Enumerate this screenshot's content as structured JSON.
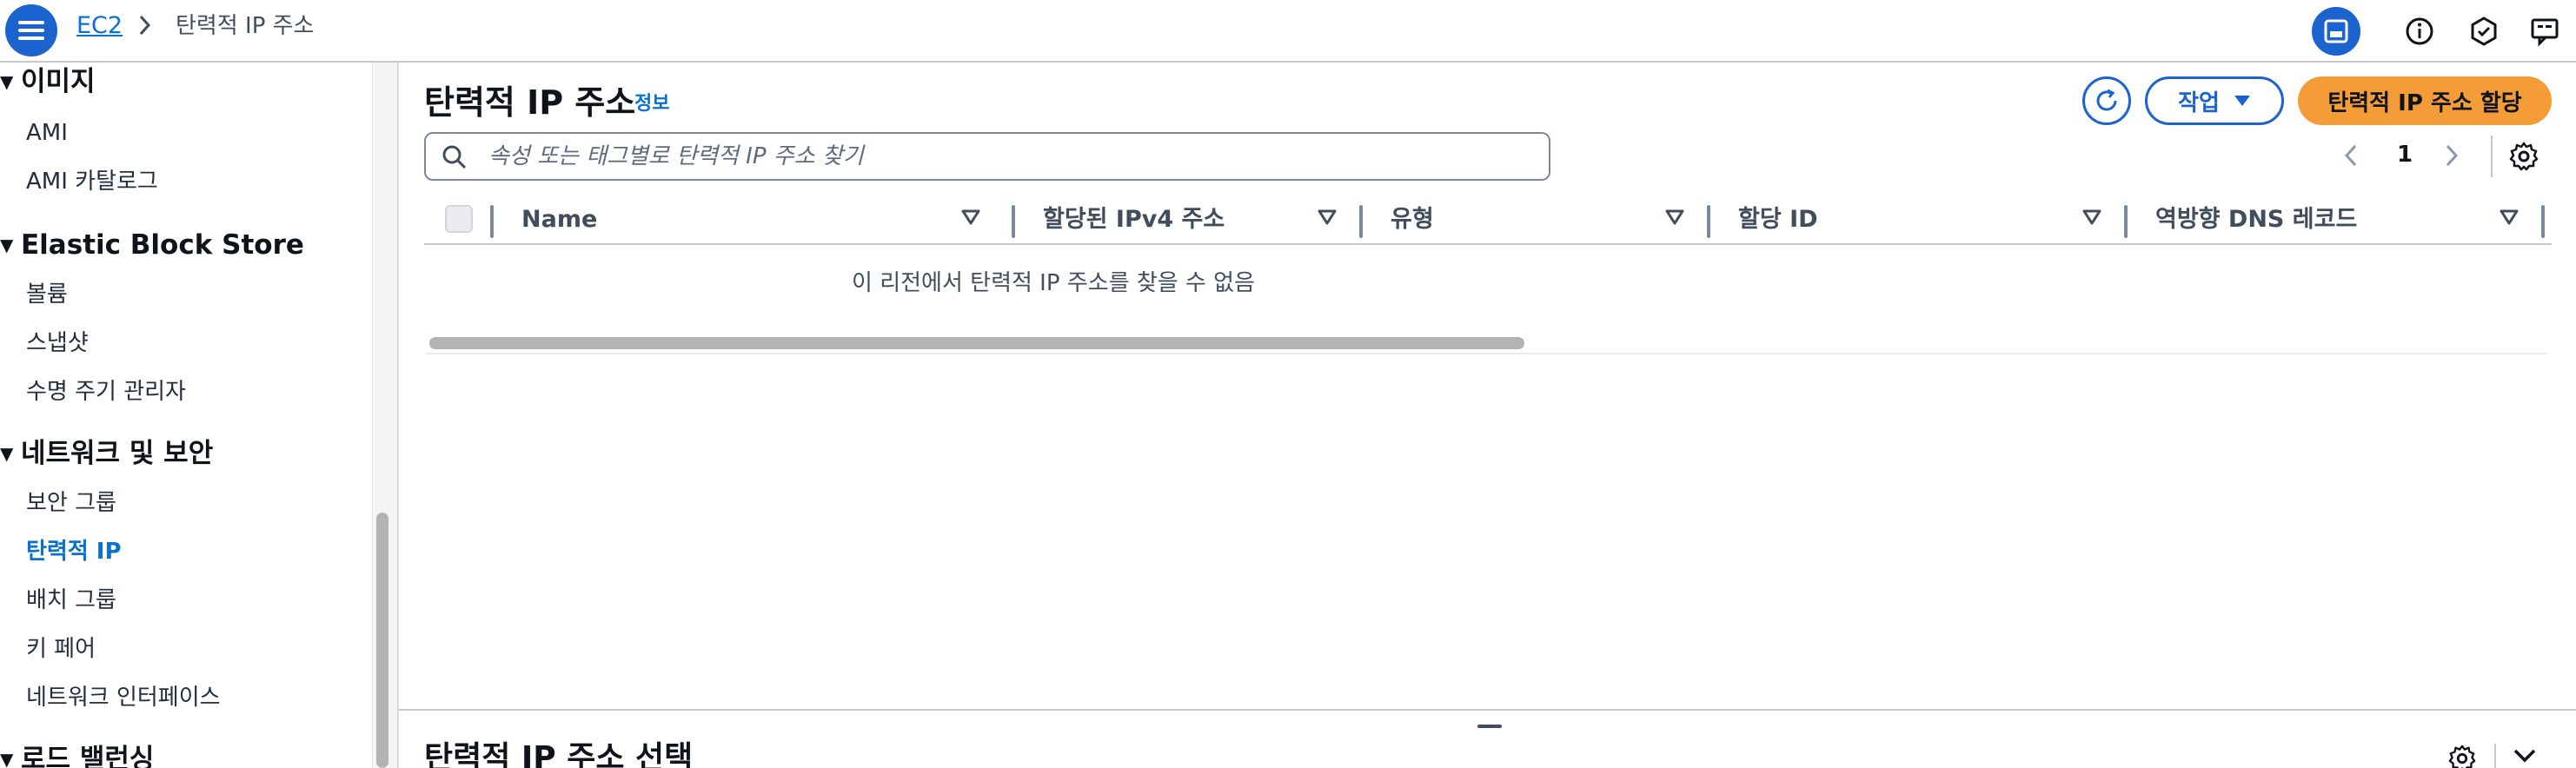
{
  "header": {
    "breadcrumb_service": "EC2",
    "breadcrumb_current": "탄력적 IP 주소"
  },
  "sidebar": {
    "sections": [
      {
        "title": "이미지",
        "items": [
          "AMI",
          "AMI 카탈로그"
        ]
      },
      {
        "title": "Elastic Block Store",
        "items": [
          "볼륨",
          "스냅샷",
          "수명 주기 관리자"
        ]
      },
      {
        "title": "네트워크 및 보안",
        "items": [
          "보안 그룹",
          "탄력적 IP",
          "배치 그룹",
          "키 페어",
          "네트워크 인터페이스"
        ]
      },
      {
        "title": "로드 밸런싱",
        "items": []
      }
    ],
    "active_item": "탄력적 IP"
  },
  "main": {
    "title": "탄력적 IP 주소",
    "info_label": "정보",
    "actions_label": "작업",
    "primary_label": "탄력적 IP 주소 할당",
    "search_placeholder": "속성 또는 태그별로 탄력적 IP 주소 찾기",
    "page_number": "1",
    "columns": [
      "Name",
      "할당된 IPv4 주소",
      "유형",
      "할당 ID",
      "역방향 DNS 레코드"
    ],
    "empty_message": "이 리전에서 탄력적 IP 주소를 찾을 수 없음"
  },
  "split_panel": {
    "title": "탄력적 IP 주소 선택"
  },
  "colors": {
    "accent": "#1b63ce",
    "link": "#0972d3",
    "primary_button": "#f39c38"
  }
}
